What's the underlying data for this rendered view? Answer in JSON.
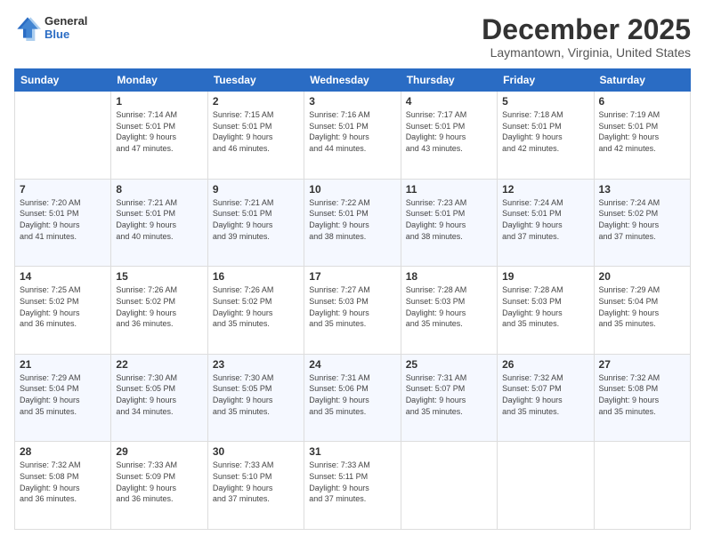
{
  "header": {
    "logo_line1": "General",
    "logo_line2": "Blue",
    "main_title": "December 2025",
    "subtitle": "Laymantown, Virginia, United States"
  },
  "days_of_week": [
    "Sunday",
    "Monday",
    "Tuesday",
    "Wednesday",
    "Thursday",
    "Friday",
    "Saturday"
  ],
  "weeks": [
    [
      {
        "day": "",
        "info": ""
      },
      {
        "day": "1",
        "info": "Sunrise: 7:14 AM\nSunset: 5:01 PM\nDaylight: 9 hours\nand 47 minutes."
      },
      {
        "day": "2",
        "info": "Sunrise: 7:15 AM\nSunset: 5:01 PM\nDaylight: 9 hours\nand 46 minutes."
      },
      {
        "day": "3",
        "info": "Sunrise: 7:16 AM\nSunset: 5:01 PM\nDaylight: 9 hours\nand 44 minutes."
      },
      {
        "day": "4",
        "info": "Sunrise: 7:17 AM\nSunset: 5:01 PM\nDaylight: 9 hours\nand 43 minutes."
      },
      {
        "day": "5",
        "info": "Sunrise: 7:18 AM\nSunset: 5:01 PM\nDaylight: 9 hours\nand 42 minutes."
      },
      {
        "day": "6",
        "info": "Sunrise: 7:19 AM\nSunset: 5:01 PM\nDaylight: 9 hours\nand 42 minutes."
      }
    ],
    [
      {
        "day": "7",
        "info": "Sunrise: 7:20 AM\nSunset: 5:01 PM\nDaylight: 9 hours\nand 41 minutes."
      },
      {
        "day": "8",
        "info": "Sunrise: 7:21 AM\nSunset: 5:01 PM\nDaylight: 9 hours\nand 40 minutes."
      },
      {
        "day": "9",
        "info": "Sunrise: 7:21 AM\nSunset: 5:01 PM\nDaylight: 9 hours\nand 39 minutes."
      },
      {
        "day": "10",
        "info": "Sunrise: 7:22 AM\nSunset: 5:01 PM\nDaylight: 9 hours\nand 38 minutes."
      },
      {
        "day": "11",
        "info": "Sunrise: 7:23 AM\nSunset: 5:01 PM\nDaylight: 9 hours\nand 38 minutes."
      },
      {
        "day": "12",
        "info": "Sunrise: 7:24 AM\nSunset: 5:01 PM\nDaylight: 9 hours\nand 37 minutes."
      },
      {
        "day": "13",
        "info": "Sunrise: 7:24 AM\nSunset: 5:02 PM\nDaylight: 9 hours\nand 37 minutes."
      }
    ],
    [
      {
        "day": "14",
        "info": "Sunrise: 7:25 AM\nSunset: 5:02 PM\nDaylight: 9 hours\nand 36 minutes."
      },
      {
        "day": "15",
        "info": "Sunrise: 7:26 AM\nSunset: 5:02 PM\nDaylight: 9 hours\nand 36 minutes."
      },
      {
        "day": "16",
        "info": "Sunrise: 7:26 AM\nSunset: 5:02 PM\nDaylight: 9 hours\nand 35 minutes."
      },
      {
        "day": "17",
        "info": "Sunrise: 7:27 AM\nSunset: 5:03 PM\nDaylight: 9 hours\nand 35 minutes."
      },
      {
        "day": "18",
        "info": "Sunrise: 7:28 AM\nSunset: 5:03 PM\nDaylight: 9 hours\nand 35 minutes."
      },
      {
        "day": "19",
        "info": "Sunrise: 7:28 AM\nSunset: 5:03 PM\nDaylight: 9 hours\nand 35 minutes."
      },
      {
        "day": "20",
        "info": "Sunrise: 7:29 AM\nSunset: 5:04 PM\nDaylight: 9 hours\nand 35 minutes."
      }
    ],
    [
      {
        "day": "21",
        "info": "Sunrise: 7:29 AM\nSunset: 5:04 PM\nDaylight: 9 hours\nand 35 minutes."
      },
      {
        "day": "22",
        "info": "Sunrise: 7:30 AM\nSunset: 5:05 PM\nDaylight: 9 hours\nand 34 minutes."
      },
      {
        "day": "23",
        "info": "Sunrise: 7:30 AM\nSunset: 5:05 PM\nDaylight: 9 hours\nand 35 minutes."
      },
      {
        "day": "24",
        "info": "Sunrise: 7:31 AM\nSunset: 5:06 PM\nDaylight: 9 hours\nand 35 minutes."
      },
      {
        "day": "25",
        "info": "Sunrise: 7:31 AM\nSunset: 5:07 PM\nDaylight: 9 hours\nand 35 minutes."
      },
      {
        "day": "26",
        "info": "Sunrise: 7:32 AM\nSunset: 5:07 PM\nDaylight: 9 hours\nand 35 minutes."
      },
      {
        "day": "27",
        "info": "Sunrise: 7:32 AM\nSunset: 5:08 PM\nDaylight: 9 hours\nand 35 minutes."
      }
    ],
    [
      {
        "day": "28",
        "info": "Sunrise: 7:32 AM\nSunset: 5:08 PM\nDaylight: 9 hours\nand 36 minutes."
      },
      {
        "day": "29",
        "info": "Sunrise: 7:33 AM\nSunset: 5:09 PM\nDaylight: 9 hours\nand 36 minutes."
      },
      {
        "day": "30",
        "info": "Sunrise: 7:33 AM\nSunset: 5:10 PM\nDaylight: 9 hours\nand 37 minutes."
      },
      {
        "day": "31",
        "info": "Sunrise: 7:33 AM\nSunset: 5:11 PM\nDaylight: 9 hours\nand 37 minutes."
      },
      {
        "day": "",
        "info": ""
      },
      {
        "day": "",
        "info": ""
      },
      {
        "day": "",
        "info": ""
      }
    ]
  ]
}
